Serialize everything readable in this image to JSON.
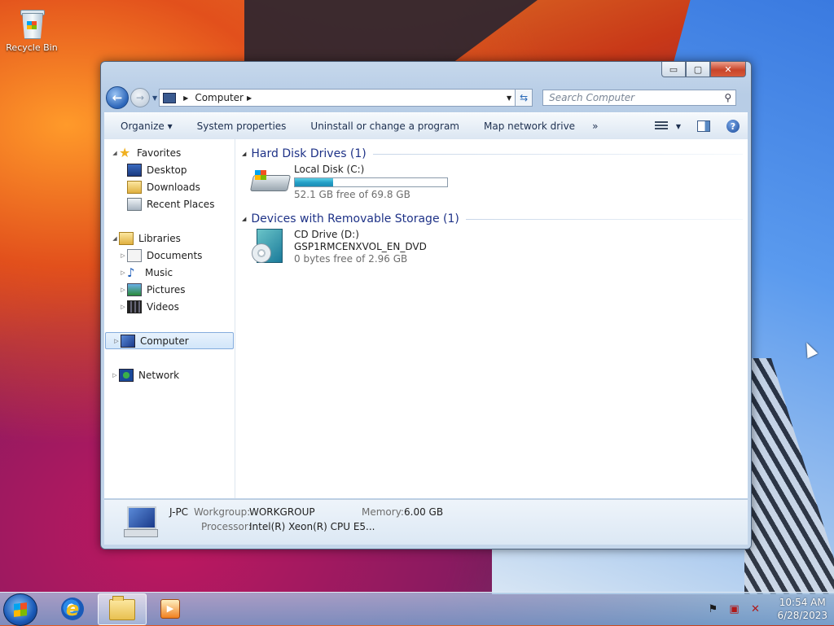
{
  "desktop": {
    "recycle_bin_label": "Recycle Bin"
  },
  "window": {
    "caption_buttons": {
      "minimize": "▭",
      "maximize": "▢",
      "close": "✕"
    },
    "address": {
      "segment": "Computer",
      "separator": "▶",
      "dropdown": "▼"
    },
    "search": {
      "placeholder": "Search Computer"
    },
    "toolbar": {
      "organize": "Organize ▾",
      "system_properties": "System properties",
      "uninstall": "Uninstall or change a program",
      "map_drive": "Map network drive",
      "more": "»"
    },
    "nav_pane": {
      "favorites": "Favorites",
      "desktop": "Desktop",
      "downloads": "Downloads",
      "recent_places": "Recent Places",
      "libraries": "Libraries",
      "documents": "Documents",
      "music": "Music",
      "pictures": "Pictures",
      "videos": "Videos",
      "computer": "Computer",
      "network": "Network"
    },
    "groups": [
      {
        "title": "Hard Disk Drives (1)",
        "drives": [
          {
            "name": "Local Disk (C:)",
            "free_text": "52.1 GB free of 69.8 GB",
            "used_fraction": 0.254
          }
        ]
      },
      {
        "title": "Devices with Removable Storage (1)",
        "drives": [
          {
            "name": "CD Drive (D:)",
            "label": "GSP1RMCENXVOL_EN_DVD",
            "free_text": "0 bytes free of 2.96 GB"
          }
        ]
      }
    ],
    "details": {
      "computer_name": "J-PC",
      "workgroup_label": "Workgroup:",
      "workgroup_value": "WORKGROUP",
      "memory_label": "Memory:",
      "memory_value": "6.00 GB",
      "processor_label": "Processor:",
      "processor_value": "Intel(R) Xeon(R) CPU E5..."
    }
  },
  "taskbar": {
    "clock_time": "10:54 AM",
    "clock_date": "6/28/2023"
  }
}
